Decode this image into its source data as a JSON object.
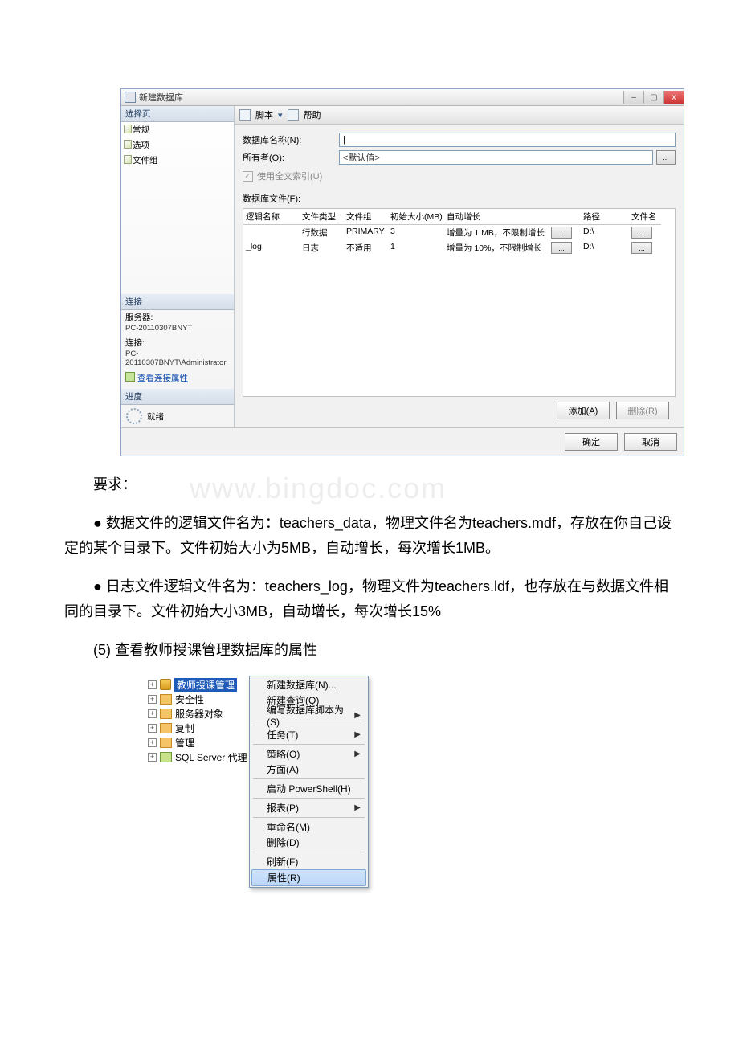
{
  "dialog": {
    "title": "新建数据库",
    "win_buttons": {
      "min": "–",
      "max": "▢",
      "close": "x"
    },
    "left": {
      "section_select": "选择页",
      "items": [
        "常规",
        "选项",
        "文件组"
      ],
      "section_conn": "连接",
      "server_label": "服务器:",
      "server": "PC-20110307BNYT",
      "conn_label": "连接:",
      "conn": "PC-20110307BNYT\\Administrator",
      "view_props": "查看连接属性",
      "section_progress": "进度",
      "ready": "就绪"
    },
    "toolbar": {
      "script": "脚本",
      "help": "帮助",
      "arrow": "▾"
    },
    "form": {
      "dbname_label": "数据库名称(N):",
      "owner_label": "所有者(O):",
      "owner_value": "<默认值>",
      "fulltext": "使用全文索引(U)",
      "files_label": "数据库文件(F):"
    },
    "grid": {
      "headers": [
        "逻辑名称",
        "文件类型",
        "文件组",
        "初始大小(MB)",
        "自动增长",
        "",
        "路径",
        "文件名"
      ],
      "rows": [
        [
          "",
          "行数据",
          "PRIMARY",
          "3",
          "增量为 1 MB，不限制增长",
          "...",
          "D:\\",
          "..."
        ],
        [
          "_log",
          "日志",
          "不适用",
          "1",
          "增量为 10%，不限制增长",
          "...",
          "D:\\",
          "..."
        ]
      ]
    },
    "buttons": {
      "add": "添加(A)",
      "delete": "删除(R)",
      "ok": "确定",
      "cancel": "取消",
      "ellipsis": "..."
    }
  },
  "body_text": {
    "req": "要求：",
    "p1": "● 数据文件的逻辑文件名为：teachers_data，物理文件名为teachers.mdf，存放在你自己设定的某个目录下。文件初始大小为5MB，自动增长，每次增长1MB。",
    "p2": "● 日志文件逻辑文件名为：teachers_log，物理文件为teachers.ldf，也存放在与数据文件相同的目录下。文件初始大小3MB，自动增长，每次增长15%",
    "p3": "(5) 查看教师授课管理数据库的属性",
    "watermark": "www.bingdoc.com"
  },
  "tree": {
    "selected": "教师授课管理",
    "items": [
      "安全性",
      "服务器对象",
      "复制",
      "管理",
      "SQL Server 代理"
    ]
  },
  "context_menu": {
    "items": [
      {
        "t": "新建数据库(N)...",
        "a": ""
      },
      {
        "t": "新建查询(Q)",
        "a": ""
      },
      {
        "t": "编写数据库脚本为(S)",
        "a": "▶"
      },
      {
        "sep": true
      },
      {
        "t": "任务(T)",
        "a": "▶"
      },
      {
        "sep": true
      },
      {
        "t": "策略(O)",
        "a": "▶"
      },
      {
        "t": "方面(A)",
        "a": ""
      },
      {
        "sep": true
      },
      {
        "t": "启动 PowerShell(H)",
        "a": ""
      },
      {
        "sep": true
      },
      {
        "t": "报表(P)",
        "a": "▶"
      },
      {
        "sep": true
      },
      {
        "t": "重命名(M)",
        "a": ""
      },
      {
        "t": "删除(D)",
        "a": ""
      },
      {
        "sep": true
      },
      {
        "t": "刷新(F)",
        "a": ""
      },
      {
        "t": "属性(R)",
        "a": "",
        "sel": true
      }
    ]
  }
}
